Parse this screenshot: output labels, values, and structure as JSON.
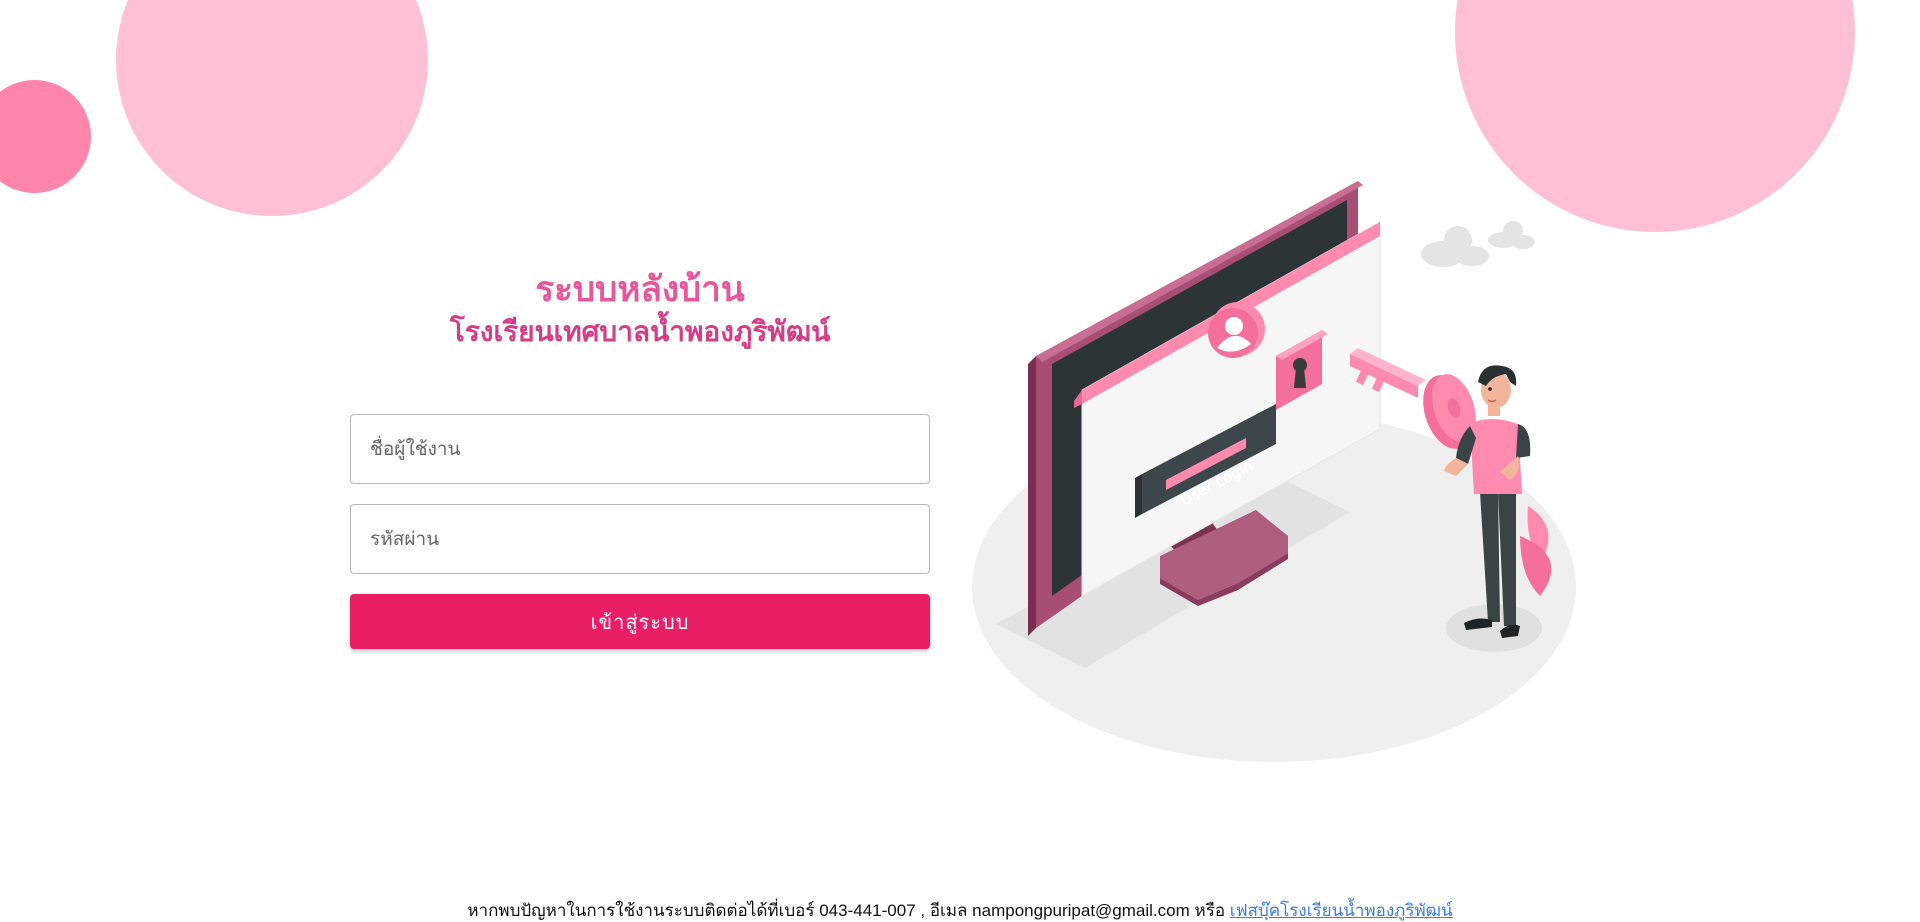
{
  "header": {
    "title": "ระบบหลังบ้าน",
    "subtitle": "โรงเรียนเทศบาลน้ำพองภูริพัฒน์"
  },
  "login_form": {
    "username_placeholder": "ชื่อผู้ใช้งาน",
    "username_value": "",
    "password_placeholder": "รหัสผ่าน",
    "password_value": "",
    "submit_label": "เข้าสู่ระบบ"
  },
  "illustration": {
    "screen_label": "User Login",
    "icon": "user-login-key-illustration"
  },
  "footer": {
    "text": "หากพบปัญหาในการใช้งานระบบติดต่อได้ที่เบอร์ 043-441-007 , อีเมล nampongpuripat@gmail.com หรือ",
    "link_label": "เฟสบุ๊คโรงเรียนน้ำพองภูริพัฒน์"
  },
  "colors": {
    "accent": "#ea1e66",
    "title_pink": "#e8559a",
    "bubble_light": "#ffbfd5",
    "bubble_dark": "#ff85aa",
    "link_blue": "#3d7be3"
  }
}
